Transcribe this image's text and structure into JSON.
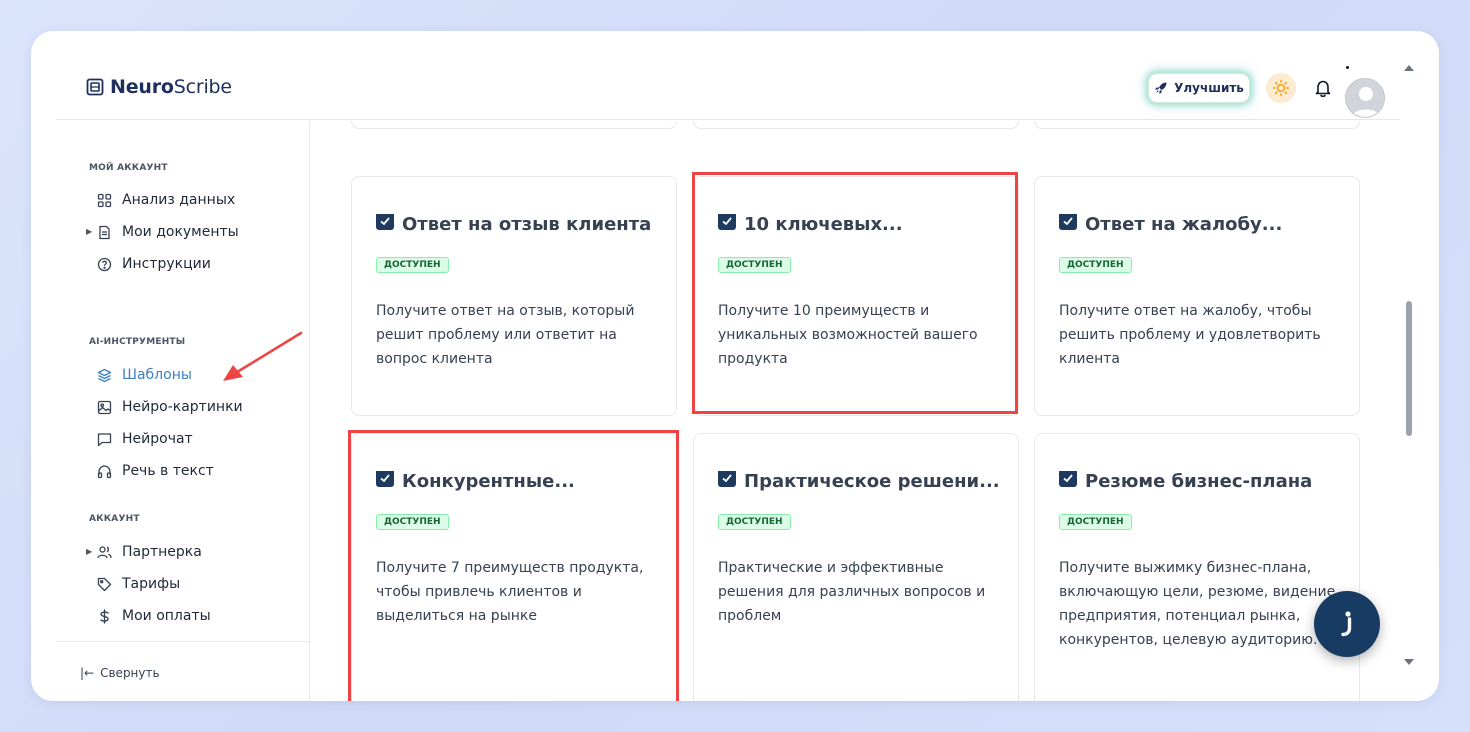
{
  "header": {
    "logo_bold": "Neuro",
    "logo_rest": "Scribe",
    "upgrade_label": "Улучшить"
  },
  "sidebar": {
    "sections": [
      {
        "label": "МОЙ АККАУНТ"
      },
      {
        "label": "AI-ИНСТРУМЕНТЫ"
      },
      {
        "label": "АККАУНТ"
      }
    ],
    "items": [
      {
        "label": "Анализ данных",
        "icon": "grid-icon"
      },
      {
        "label": "Мои документы",
        "icon": "document-icon"
      },
      {
        "label": "Инструкции",
        "icon": "help-circle-icon"
      },
      {
        "label": "Шаблоны",
        "icon": "layers-icon"
      },
      {
        "label": "Нейро-картинки",
        "icon": "image-icon"
      },
      {
        "label": "Нейрочат",
        "icon": "chat-icon"
      },
      {
        "label": "Речь в текст",
        "icon": "headphones-icon"
      },
      {
        "label": "Партнерка",
        "icon": "users-icon"
      },
      {
        "label": "Тарифы",
        "icon": "tag-icon"
      },
      {
        "label": "Мои оплаты",
        "icon": "dollar-icon"
      }
    ],
    "collapse_label": "Свернуть"
  },
  "cards": [
    {
      "title": "Ответ на отзыв клиента",
      "badge": "ДОСТУПЕН",
      "desc": "Получите ответ на отзыв, который решит проблему или ответит на вопрос клиента"
    },
    {
      "title": "10 ключевых...",
      "badge": "ДОСТУПЕН",
      "desc": "Получите 10 преимуществ и уникальных возможностей вашего продукта"
    },
    {
      "title": "Ответ на жалобу...",
      "badge": "ДОСТУПЕН",
      "desc": "Получите ответ на жалобу, чтобы решить проблему и удовлетворить клиента"
    },
    {
      "title": "Конкурентные...",
      "badge": "ДОСТУПЕН",
      "desc": "Получите 7 преимуществ продукта, чтобы привлечь клиентов и выделиться на рынке"
    },
    {
      "title": "Практическое решени...",
      "badge": "ДОСТУПЕН",
      "desc": "Практические и эффективные решения для различных вопросов и проблем"
    },
    {
      "title": "Резюме бизнес-плана",
      "badge": "ДОСТУПЕН",
      "desc": "Получите выжимку бизнес-плана, включающую цели, резюме, видение предприятия, потенциал рынка, конкурентов, целевую аудиторию."
    }
  ],
  "colors": {
    "accent": "#3b82c4",
    "brand": "#1e2f5c",
    "highlight": "#ef4444",
    "badge_bg": "#dcfce7",
    "badge_text": "#166534"
  }
}
